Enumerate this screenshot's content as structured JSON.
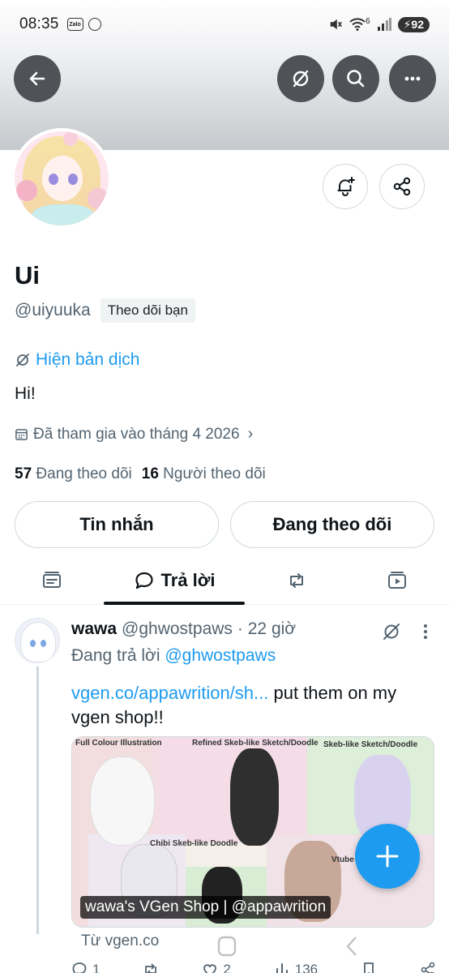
{
  "status_bar": {
    "time": "08:35",
    "zalo_label": "Zalo",
    "signal_label": "6",
    "battery": "92"
  },
  "profile": {
    "name": "Ui",
    "handle": "@uiyuuka",
    "follows_you": "Theo dõi bạn",
    "translate": "Hiện bản dịch",
    "bio": "Hi!",
    "joined": "Đã tham gia vào tháng 4 2026",
    "following_count": "57",
    "following_label": "Đang theo dõi",
    "followers_count": "16",
    "followers_label": "Người theo dõi"
  },
  "buttons": {
    "message": "Tin nhắn",
    "following": "Đang theo dõi"
  },
  "tabs": {
    "replies": "Trả lời"
  },
  "tweet": {
    "name": "wawa",
    "handle": "@ghwostpaws",
    "time": "· 22 giờ",
    "replying_prefix": "Đang trả lời",
    "replying_to": "@ghwostpaws",
    "link": "vgen.co/appawrition/sh...",
    "text": " put them on my vgen shop!!",
    "card_title": "wawa's VGen Shop | @appawrition",
    "card_source": "Từ vgen.co",
    "art_labels": [
      "Full Colour Illustration",
      "Refined Skeb-like Sketch/Doodle",
      "Skeb-like Sketch/Doodle",
      "Chibi Skeb-like Doodle",
      "Vtube"
    ],
    "reply_count": "1",
    "like_count": "2",
    "view_count": "136"
  },
  "colors": {
    "accent": "#1d9bf0",
    "text": "#0f1419",
    "secondary": "#536471",
    "border": "#cfd9de"
  }
}
